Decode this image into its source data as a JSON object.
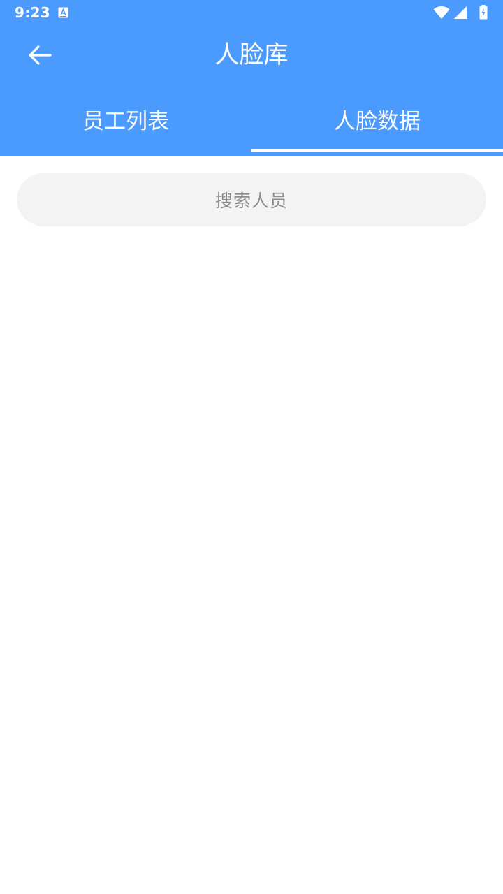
{
  "status_bar": {
    "time": "9:23",
    "icons": [
      "app-notification-icon",
      "wifi-icon",
      "cell-signal-icon",
      "battery-charging-icon"
    ]
  },
  "toolbar": {
    "title": "人脸库",
    "back_icon": "arrow-left-icon"
  },
  "tabs": [
    {
      "label": "员工列表",
      "selected": false
    },
    {
      "label": "人脸数据",
      "selected": true
    }
  ],
  "search": {
    "placeholder": "搜索人员",
    "value": ""
  },
  "colors": {
    "primary": "#4a9bfd",
    "on_primary": "#ffffff",
    "search_bg": "#f3f3f3",
    "placeholder": "#8a8a8a"
  }
}
